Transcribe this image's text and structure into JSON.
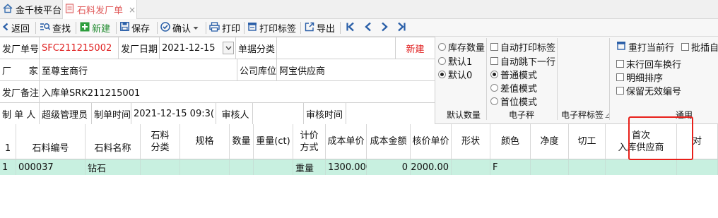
{
  "tabs": [
    {
      "label": "金千枝平台",
      "icon": "home-icon"
    },
    {
      "label": "石料发厂单",
      "icon": "document-icon",
      "close": "×"
    }
  ],
  "toolbar": {
    "back": "返回",
    "search": "查找",
    "new": "新建",
    "save": "保存",
    "confirm": "确认",
    "print": "打印",
    "print_label": "打印标签",
    "export": "导出"
  },
  "form": {
    "order_no_label": "发厂单号",
    "order_no": "SFC211215002",
    "date_label": "发厂日期",
    "date": "2021-12-15",
    "doc_class_label": "单据分类",
    "doc_class": "",
    "new_badge": "新建",
    "factory_label": "厂      家",
    "factory": "至尊宝商行",
    "warehouse_label": "公司库位",
    "warehouse": "阿宝供应商",
    "remark_label": "发厂备注",
    "remark": "入库单SRK211215001",
    "maker_label": "制 单 人",
    "maker": "超级管理员",
    "make_time_label": "制单时间",
    "make_time": "2021-12-15 09:3(",
    "auditor_label": "审核人",
    "auditor": "",
    "audit_time_label": "审核时间",
    "audit_time": ""
  },
  "options": {
    "qty_group": [
      "库存数量",
      "默认1",
      "默认0"
    ],
    "qty_selected": "默认0",
    "qty_group_label": "默认数量",
    "scale_checks": [
      "自动打印标签",
      "自动跳下一行"
    ],
    "scale_modes": [
      "普通模式",
      "差值模式",
      "首位模式"
    ],
    "scale_selected": "普通模式",
    "scale_group_label": "电子秤",
    "scale_label_group": "电子秤标签",
    "reprint": "重打当前行",
    "batch_insert": "批插自",
    "general_checks": [
      "末行回车换行",
      "明细排序",
      "保留无效编号"
    ],
    "general_group_label": "通用"
  },
  "grid": {
    "headers": [
      "",
      "石料编号",
      "石料名称",
      "石料\n分类",
      "规格",
      "数量",
      "重量(ct)",
      "计价\n方式",
      "成本单价",
      "成本金额",
      "核价单价",
      "形状",
      "颜色",
      "净度",
      "切工",
      "首次\n入库供应商",
      "对"
    ],
    "row_number_header": "1",
    "rows": [
      [
        "1",
        "000037",
        "钻石",
        "",
        "",
        "",
        "",
        "重量",
        "1300.000",
        "0",
        "2000.00",
        "",
        "F",
        "",
        "",
        "",
        ""
      ]
    ]
  },
  "colors": {
    "accent_red": "#e02020",
    "row_highlight": "#c8f0e0",
    "highlight_box": "#e8201a"
  }
}
